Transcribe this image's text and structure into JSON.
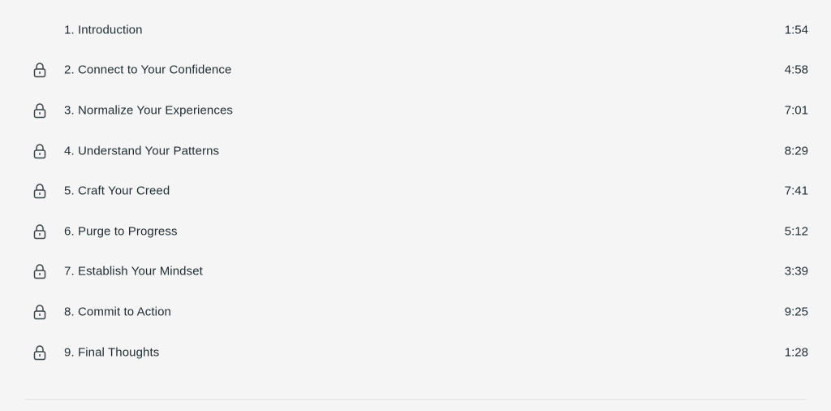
{
  "lessons": [
    {
      "title": "1. Introduction",
      "duration": "1:54",
      "locked": false,
      "icon": ""
    },
    {
      "title": "2. Connect to Your Confidence",
      "duration": "4:58",
      "locked": true,
      "icon": "lock-icon"
    },
    {
      "title": "3. Normalize Your Experiences",
      "duration": "7:01",
      "locked": true,
      "icon": "lock-icon"
    },
    {
      "title": "4. Understand Your Patterns",
      "duration": "8:29",
      "locked": true,
      "icon": "lock-icon"
    },
    {
      "title": "5. Craft Your Creed",
      "duration": "7:41",
      "locked": true,
      "icon": "lock-icon"
    },
    {
      "title": "6. Purge to Progress",
      "duration": "5:12",
      "locked": true,
      "icon": "lock-icon"
    },
    {
      "title": "7. Establish Your Mindset",
      "duration": "3:39",
      "locked": true,
      "icon": "lock-icon"
    },
    {
      "title": "8. Commit to Action",
      "duration": "9:25",
      "locked": true,
      "icon": "lock-icon"
    },
    {
      "title": "9. Final Thoughts",
      "duration": "1:28",
      "locked": true,
      "icon": "lock-icon"
    }
  ],
  "colors": {
    "background": "#f5f5f5",
    "text": "#1f2d33",
    "icon": "#3a4448"
  }
}
